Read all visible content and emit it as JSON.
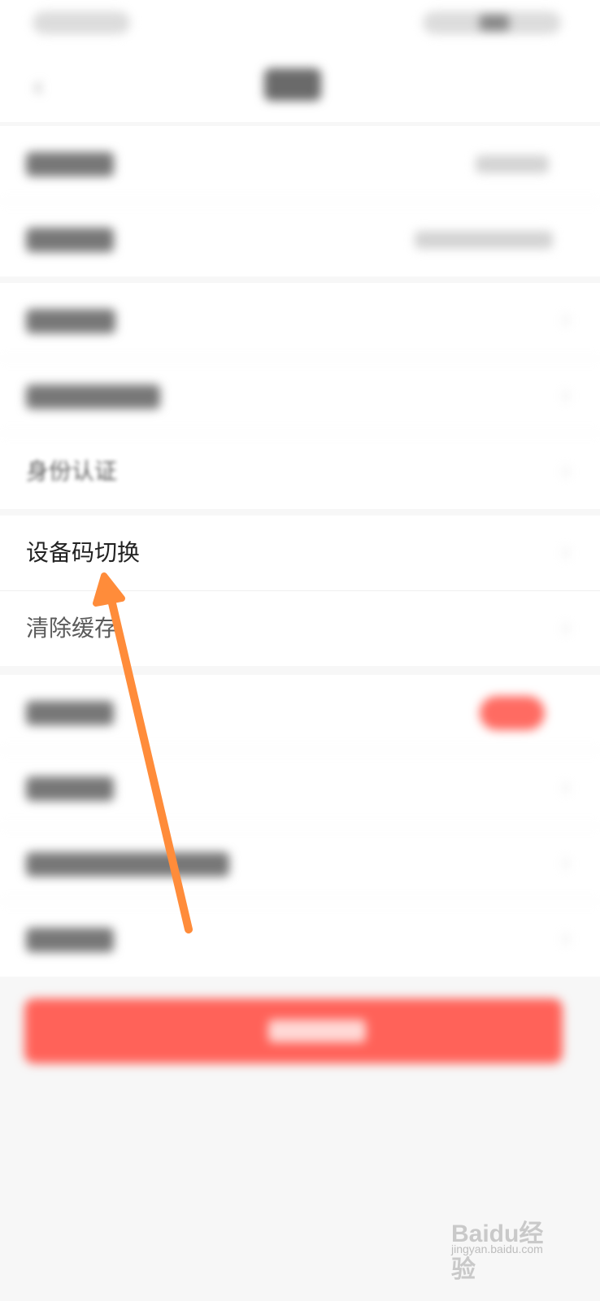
{
  "page": {
    "background": "#f7f7f7",
    "accent_color": "#ff6259",
    "annotation_color": "#ff8c3a"
  },
  "settings": {
    "device_code_switch": "设备码切换",
    "clear_cache": "清除缓存",
    "identity_verification": "身份认证"
  },
  "watermark": {
    "brand": "Baidu经验",
    "url": "jingyan.baidu.com"
  }
}
